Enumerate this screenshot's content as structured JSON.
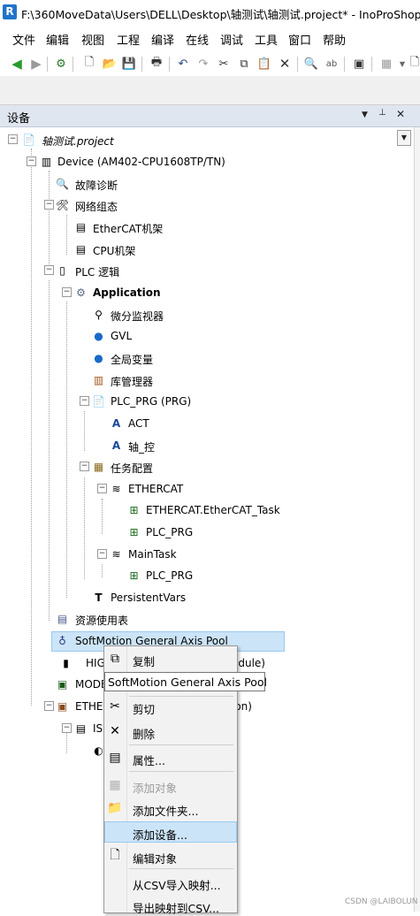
{
  "window": {
    "title": "F:\\360MoveData\\Users\\DELL\\Desktop\\轴测试\\轴测试.project* - InoProShop(V1"
  },
  "menu": [
    "文件",
    "编辑",
    "视图",
    "工程",
    "编译",
    "在线",
    "调试",
    "工具",
    "窗口",
    "帮助"
  ],
  "panel": {
    "title": "设备",
    "dropdown_icon": "▼",
    "pin_icon": "📌",
    "close_icon": "✕"
  },
  "tree": [
    {
      "label": "轴测试.project",
      "icon": "project-icon"
    },
    {
      "label": "Device (AM402-CPU1608TP/TN)",
      "icon": "device-icon"
    },
    {
      "label": "故障诊断",
      "icon": "diagnosis-icon"
    },
    {
      "label": "网络组态",
      "icon": "network-config-icon"
    },
    {
      "label": "EtherCAT机架",
      "icon": "rack-icon"
    },
    {
      "label": "CPU机架",
      "icon": "rack-icon"
    },
    {
      "label": "PLC 逻辑",
      "icon": "plc-logic-icon"
    },
    {
      "label": "Application",
      "icon": "gear-icon"
    },
    {
      "label": "微分监视器",
      "icon": "monitor-icon"
    },
    {
      "label": "GVL",
      "icon": "globe-icon"
    },
    {
      "label": "全局变量",
      "icon": "globe-icon"
    },
    {
      "label": "库管理器",
      "icon": "library-icon"
    },
    {
      "label": "PLC_PRG (PRG)",
      "icon": "program-icon"
    },
    {
      "label": "ACT",
      "icon": "action-icon"
    },
    {
      "label": "轴_控",
      "icon": "action-icon"
    },
    {
      "label": "任务配置",
      "icon": "task-config-icon"
    },
    {
      "label": "ETHERCAT",
      "icon": "task-icon"
    },
    {
      "label": "ETHERCAT.EtherCAT_Task",
      "icon": "task-call-icon"
    },
    {
      "label": "PLC_PRG",
      "icon": "task-call-icon"
    },
    {
      "label": "MainTask",
      "icon": "task-icon"
    },
    {
      "label": "PLC_PRG",
      "icon": "task-call-icon"
    },
    {
      "label": "PersistentVars",
      "icon": "persistent-icon"
    },
    {
      "label": "资源使用表",
      "icon": "table-icon"
    },
    {
      "label": "SoftMotion General Axis Pool",
      "icon": "axis-pool-icon"
    },
    {
      "label": "HIG",
      "icon": "module-icon",
      "suffix": "odule)"
    },
    {
      "label": "MODB",
      "icon": "modbus-icon"
    },
    {
      "label": "ETHER",
      "icon": "ethercat-master-icon",
      "suffix": "ion)"
    },
    {
      "label": "IS",
      "icon": "slave-icon"
    },
    {
      "label": "",
      "icon": "axis-icon"
    }
  ],
  "context_menu": [
    {
      "label": "复制",
      "icon": "copy-icon",
      "disabled": false
    },
    {
      "label": "剪切",
      "icon": "cut-icon",
      "disabled": false
    },
    {
      "label": "删除",
      "icon": "delete-icon",
      "disabled": false
    },
    {
      "label": "属性...",
      "icon": "properties-icon",
      "disabled": false
    },
    {
      "label": "添加对象",
      "icon": "add-object-icon",
      "disabled": true
    },
    {
      "label": "添加文件夹...",
      "icon": "folder-icon",
      "disabled": false
    },
    {
      "label": "添加设备...",
      "icon": "",
      "disabled": false,
      "highlighted": true
    },
    {
      "label": "编辑对象",
      "icon": "edit-object-icon",
      "disabled": false
    },
    {
      "label": "从CSV导入映射...",
      "icon": "",
      "disabled": false
    },
    {
      "label": "导出映射到CSV...",
      "icon": "",
      "disabled": false
    }
  ],
  "tooltip": "SoftMotion General Axis Pool",
  "watermark": "CSDN @LAIBOLUN"
}
